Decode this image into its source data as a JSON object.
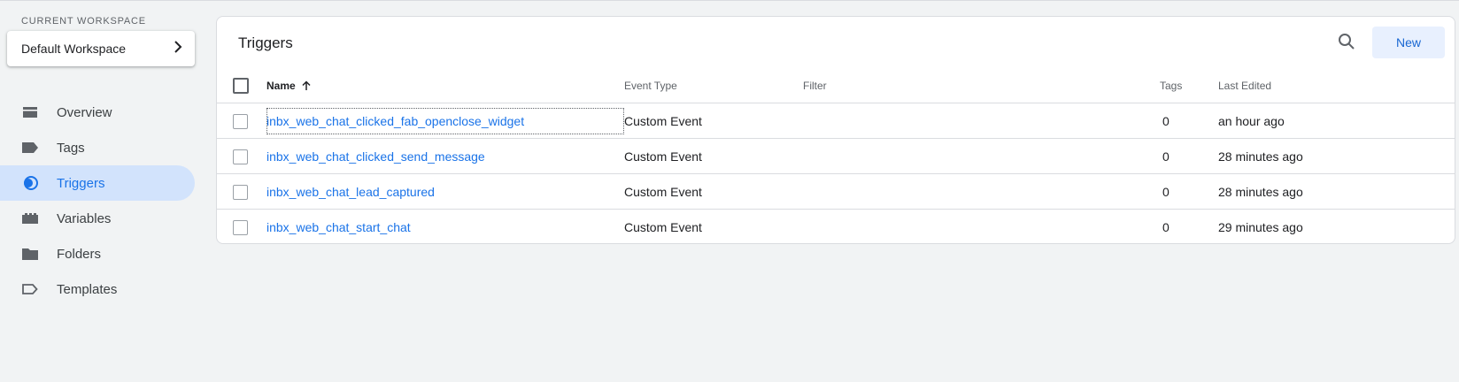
{
  "workspace": {
    "label": "CURRENT WORKSPACE",
    "name": "Default Workspace"
  },
  "nav": {
    "items": [
      {
        "label": "Overview",
        "icon": "overview-icon"
      },
      {
        "label": "Tags",
        "icon": "tag-icon"
      },
      {
        "label": "Triggers",
        "icon": "triggers-icon",
        "active": true
      },
      {
        "label": "Variables",
        "icon": "variables-icon"
      },
      {
        "label": "Folders",
        "icon": "folder-icon"
      },
      {
        "label": "Templates",
        "icon": "templates-icon"
      }
    ]
  },
  "main": {
    "title": "Triggers",
    "new_label": "New",
    "columns": {
      "name": "Name",
      "event_type": "Event Type",
      "filter": "Filter",
      "tags": "Tags",
      "last_edited": "Last Edited"
    },
    "rows": [
      {
        "name": "inbx_web_chat_clicked_fab_openclose_widget",
        "event_type": "Custom Event",
        "filter": "",
        "tags": "0",
        "last_edited": "an hour ago"
      },
      {
        "name": "inbx_web_chat_clicked_send_message",
        "event_type": "Custom Event",
        "filter": "",
        "tags": "0",
        "last_edited": "28 minutes ago"
      },
      {
        "name": "inbx_web_chat_lead_captured",
        "event_type": "Custom Event",
        "filter": "",
        "tags": "0",
        "last_edited": "28 minutes ago"
      },
      {
        "name": "inbx_web_chat_start_chat",
        "event_type": "Custom Event",
        "filter": "",
        "tags": "0",
        "last_edited": "29 minutes ago"
      }
    ]
  },
  "colors": {
    "accent": "#1a73e8",
    "active_nav_bg": "#d2e3fc",
    "new_button_bg": "#e8f0fe",
    "page_bg": "#f1f3f4"
  }
}
